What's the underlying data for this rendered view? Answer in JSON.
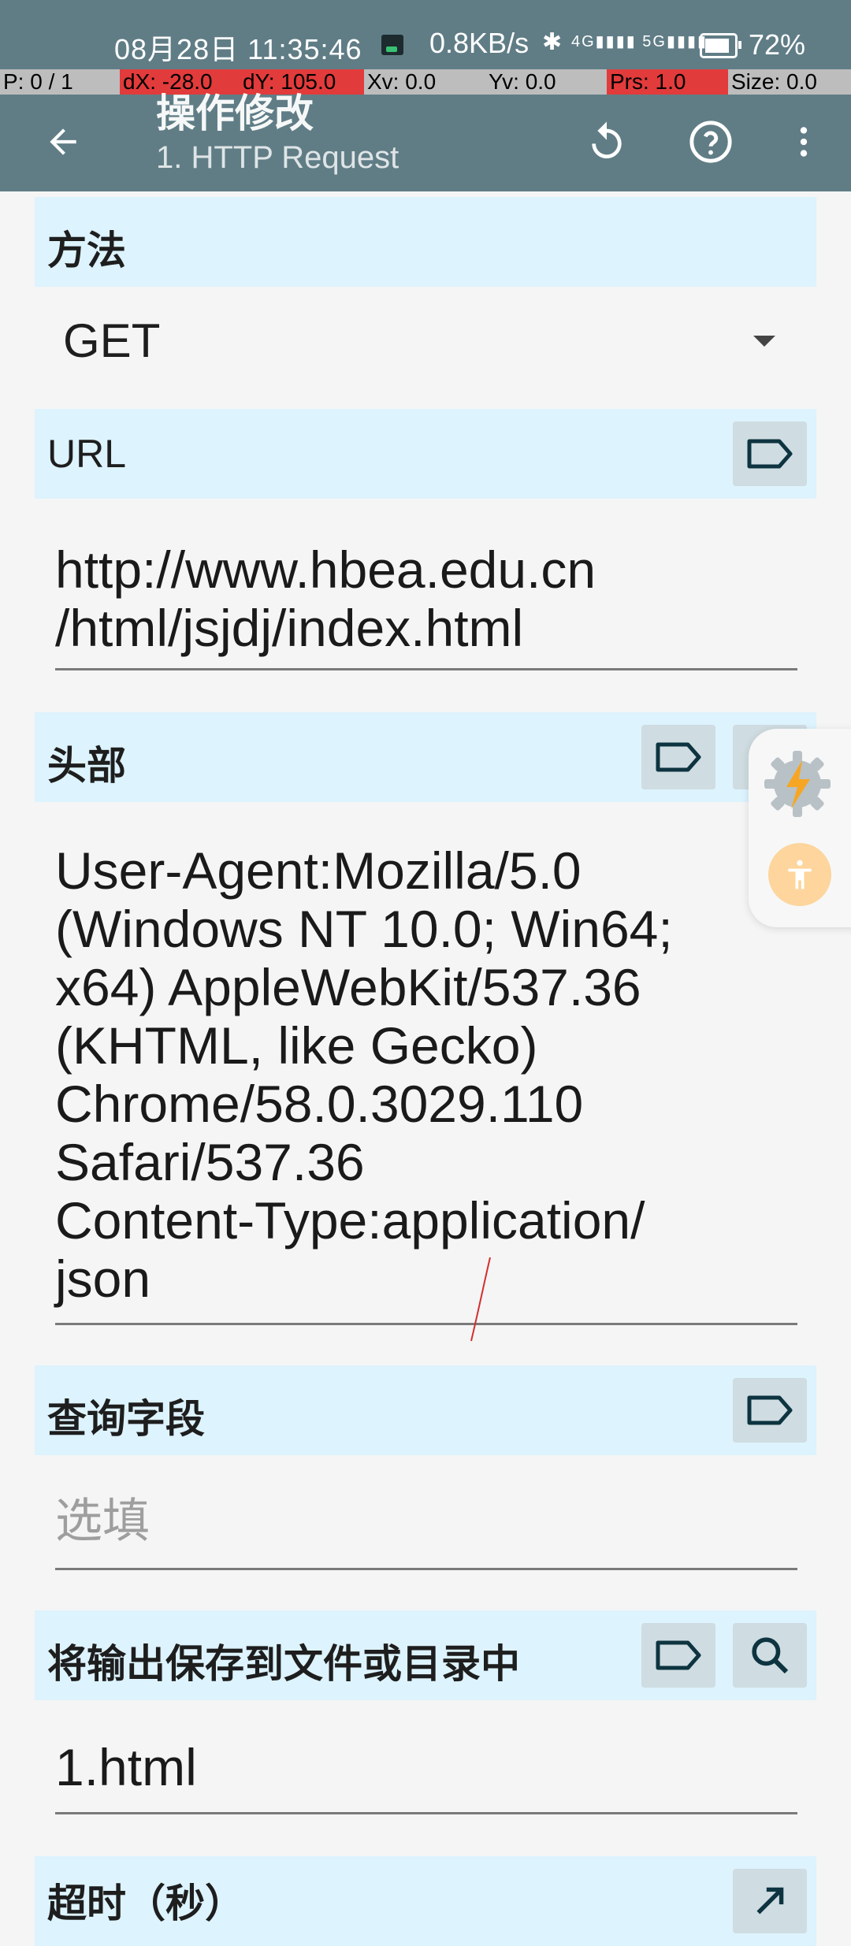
{
  "status_bar": {
    "time": "08月28日 11:35:46",
    "network_speed": "0.8KB/s",
    "signal_text": "4G▮▮▮▮ 5G▮▮▮▮",
    "bluetooth_glyph": "✱",
    "battery": "72%"
  },
  "pointer_bar": {
    "p": "P: 0 / 1",
    "dx": "dX: -28.0",
    "dy": "dY: 105.0",
    "xv": "Xv: 0.0",
    "yv": "Yv: 0.0",
    "prs": "Prs: 1.0",
    "size": "Size: 0.0"
  },
  "app_bar": {
    "title": "操作修改",
    "subtitle": "1. HTTP Request",
    "back_icon": "arrow-back-icon",
    "reset_icon": "reset-icon",
    "help_icon": "help-icon",
    "more_icon": "more-vert-icon"
  },
  "form": {
    "method": {
      "label": "方法",
      "value": "GET"
    },
    "url": {
      "label": "URL",
      "value": "http://www.hbea.edu.cn\n/html/jsjdj/index.html"
    },
    "headers": {
      "label": "头部",
      "value": "User-Agent:Mozilla/5.0\n(Windows NT 10.0; Win64;\nx64) AppleWebKit/537.36\n(KHTML, like Gecko)\nChrome/58.0.3029.110\nSafari/537.36\nContent-Type:application/\njson"
    },
    "query": {
      "label": "查询字段",
      "placeholder": "选填"
    },
    "output_file": {
      "label": "将输出保存到文件或目录中",
      "value": "1.html"
    },
    "timeout": {
      "label": "超时（秒）"
    }
  },
  "colors": {
    "app_bar": "#607d86",
    "section_header": "#ddf3fd",
    "tag_button": "#cfdce1",
    "icon_dark": "#0d3440",
    "debug_red": "#e23b3b"
  }
}
